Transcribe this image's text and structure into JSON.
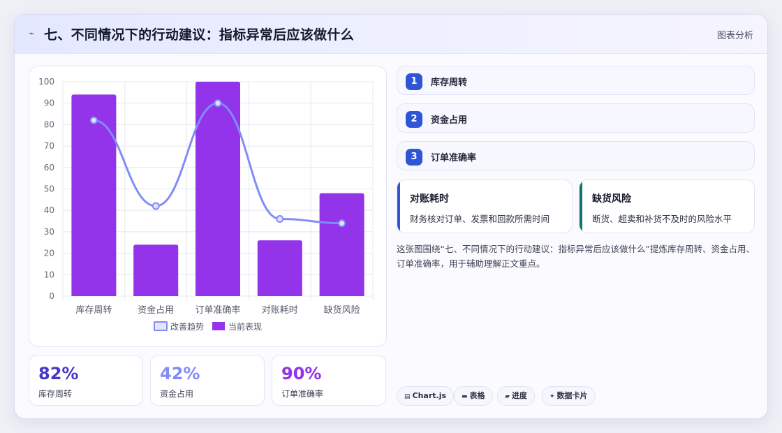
{
  "header": {
    "icon": "trend-zigzag-icon",
    "title": "七、不同情况下的行动建议：指标异常后应该做什么",
    "tag": "图表分析"
  },
  "chart_data": {
    "type": "bar",
    "categories": [
      "库存周转",
      "资金占用",
      "订单准确率",
      "对账耗时",
      "缺货风险"
    ],
    "series": [
      {
        "name": "当前表现",
        "type": "bar",
        "values": [
          94,
          24,
          100,
          26,
          48
        ],
        "color": "#9333ea"
      },
      {
        "name": "改善趋势",
        "type": "line",
        "values": [
          82,
          42,
          90,
          36,
          34
        ],
        "color": "#818cf8"
      }
    ],
    "ylim": [
      0,
      100
    ],
    "yticks": [
      0,
      10,
      20,
      30,
      40,
      50,
      60,
      70,
      80,
      90,
      100
    ],
    "grid": true,
    "legend": "bottom"
  },
  "stats": [
    {
      "value": "82%",
      "label": "库存周转",
      "color": "#4338ca"
    },
    {
      "value": "42%",
      "label": "资金占用",
      "color": "#818cf8"
    },
    {
      "value": "90%",
      "label": "订单准确率",
      "color": "#9333ea"
    }
  ],
  "steps": [
    {
      "num": "1",
      "label": "库存周转"
    },
    {
      "num": "2",
      "label": "资金占用"
    },
    {
      "num": "3",
      "label": "订单准确率"
    }
  ],
  "info_cards": [
    {
      "title": "对账耗时",
      "desc": "财务核对订单、发票和回款所需时间",
      "accent": "#2f55d4"
    },
    {
      "title": "缺货风险",
      "desc": "断货、超卖和补货不及时的风险水平",
      "accent": "#0f766e"
    }
  ],
  "summary": "这张图围绕“七、不同情况下的行动建议：指标异常后应该做什么”提炼库存周转、资金占用、订单准确率，用于辅助理解正文重点。",
  "chips": [
    {
      "icon": "chart-icon",
      "glyph": "▤",
      "label": "Chart.js"
    },
    {
      "icon": "table-icon",
      "glyph": "▬",
      "label": "表格"
    },
    {
      "icon": "progress-icon",
      "glyph": "▰",
      "label": "进度"
    },
    {
      "icon": "sparkle-icon",
      "glyph": "✦",
      "label": "数据卡片"
    }
  ]
}
